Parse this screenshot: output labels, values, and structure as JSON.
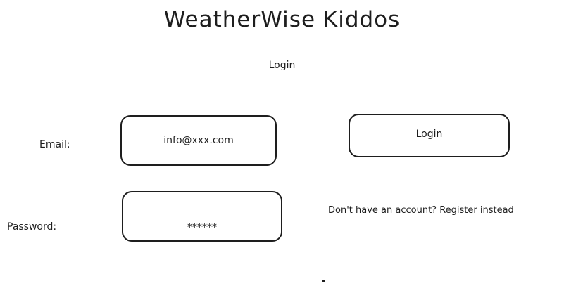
{
  "header": {
    "title": "WeatherWise Kiddos",
    "subtitle": "Login"
  },
  "form": {
    "email_label": "Email:",
    "email_value": "info@xxx.com",
    "password_label": "Password:",
    "password_value": "******"
  },
  "actions": {
    "login_label": "Login",
    "register_text": "Don't have an account? Register instead"
  }
}
